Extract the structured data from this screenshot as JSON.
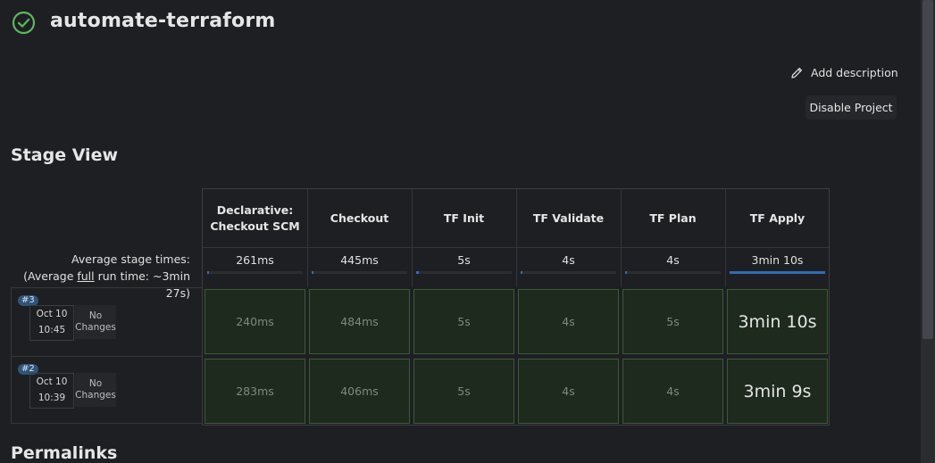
{
  "header": {
    "title": "automate-terraform",
    "status_icon": "check-circle-icon",
    "status_color": "#5cb85c"
  },
  "actions": {
    "add_description": "Add description",
    "disable_project": "Disable Project"
  },
  "stage_view": {
    "title": "Stage View",
    "avg_label_1": "Average stage times:",
    "avg_label_2a": "(Average ",
    "avg_label_2b": "full",
    "avg_label_2c": " run time: ~3min",
    "avg_label_3": "27s)",
    "stages": [
      {
        "name_line1": "Declarative:",
        "name_line2": "Checkout SCM",
        "avg": "261ms",
        "avg_fraction": 0.01
      },
      {
        "name_line1": "Checkout",
        "name_line2": "",
        "avg": "445ms",
        "avg_fraction": 0.01
      },
      {
        "name_line1": "TF Init",
        "name_line2": "",
        "avg": "5s",
        "avg_fraction": 0.03
      },
      {
        "name_line1": "TF Validate",
        "name_line2": "",
        "avg": "4s",
        "avg_fraction": 0.02
      },
      {
        "name_line1": "TF Plan",
        "name_line2": "",
        "avg": "4s",
        "avg_fraction": 0.02
      },
      {
        "name_line1": "TF Apply",
        "name_line2": "",
        "avg": "3min 10s",
        "avg_fraction": 1.0
      }
    ],
    "builds": [
      {
        "number": "#3",
        "date": "Oct 10",
        "time": "10:45",
        "changes_1": "No",
        "changes_2": "Changes",
        "durations": [
          "240ms",
          "484ms",
          "5s",
          "4s",
          "5s",
          "3min 10s"
        ]
      },
      {
        "number": "#2",
        "date": "Oct 10",
        "time": "10:39",
        "changes_1": "No",
        "changes_2": "Changes",
        "durations": [
          "283ms",
          "406ms",
          "5s",
          "4s",
          "4s",
          "3min 9s"
        ]
      }
    ],
    "success_color": "#1d2a1d"
  },
  "permalinks": {
    "title": "Permalinks"
  }
}
